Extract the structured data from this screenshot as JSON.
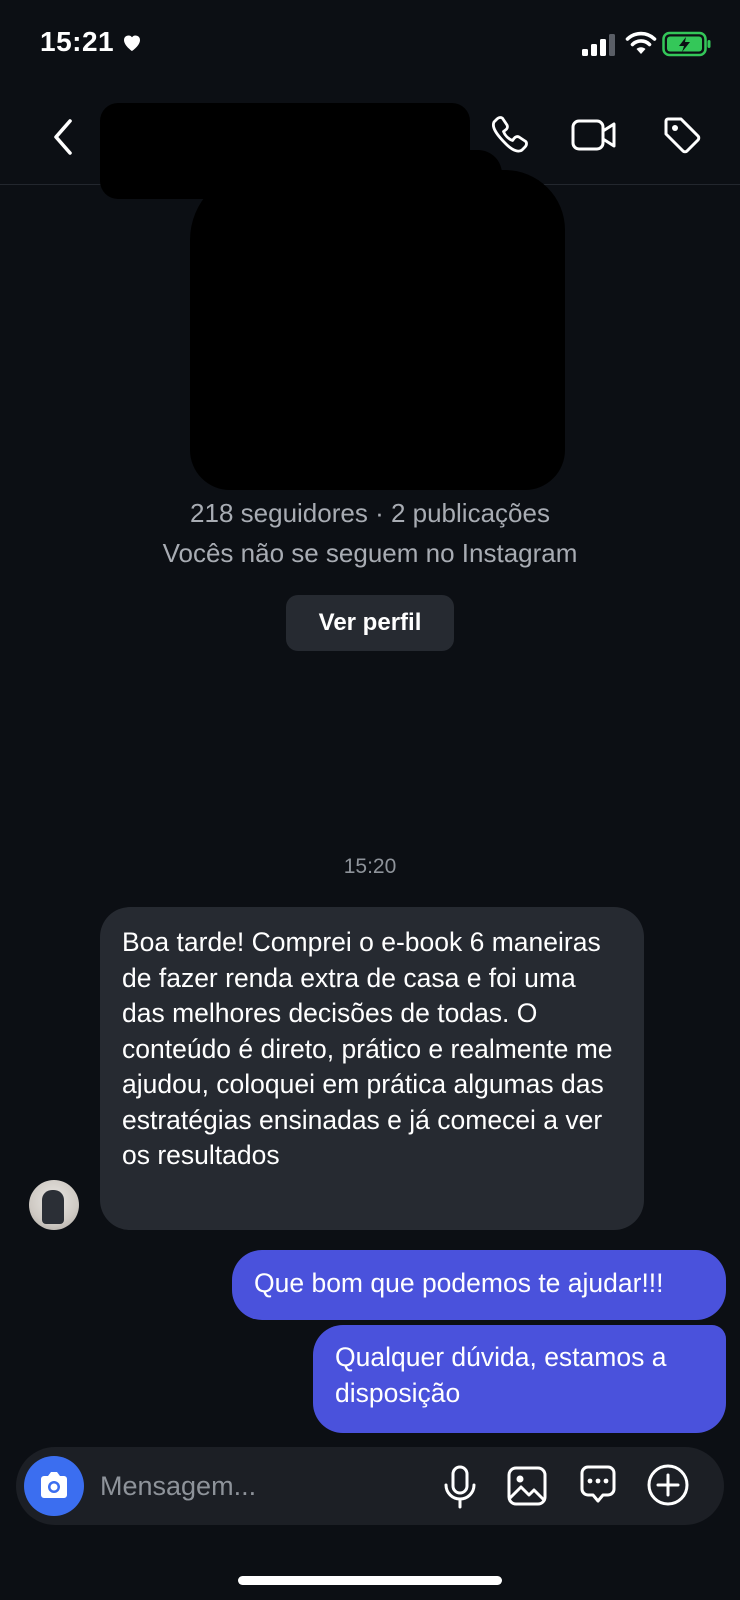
{
  "status_bar": {
    "time": "15:21",
    "heart_icon": "heart-icon",
    "signal_icon": "cellular-signal-icon",
    "wifi_icon": "wifi-icon",
    "battery_icon": "battery-charging-icon",
    "battery_color": "#34c759"
  },
  "header": {
    "back_icon": "chevron-left-icon",
    "call_icon": "phone-icon",
    "video_icon": "video-camera-icon",
    "tag_icon": "tag-icon"
  },
  "profile": {
    "stats": "218 seguidores · 2 publicações",
    "follow_status": "Vocês não se seguem no Instagram",
    "view_profile_label": "Ver perfil"
  },
  "conversation": {
    "timestamp": "15:20",
    "incoming": [
      {
        "text": "Boa tarde! Comprei o e-book 6 maneiras de fazer renda extra de casa e foi uma das melhores decisões de todas. O conteúdo é direto, prático e realmente me ajudou, coloquei em prática algumas das estratégias ensinadas e já comecei a ver os resultados"
      }
    ],
    "outgoing": [
      {
        "text": "Que bom que podemos te ajudar!!!"
      },
      {
        "text": "Qualquer dúvida, estamos a disposição"
      }
    ],
    "outgoing_color": "#4a52dc",
    "incoming_color": "#262a31"
  },
  "composer": {
    "placeholder": "Mensagem...",
    "camera_icon": "camera-icon",
    "mic_icon": "microphone-icon",
    "gallery_icon": "image-gallery-icon",
    "sticker_icon": "sticker-chat-icon",
    "plus_icon": "plus-circle-icon",
    "camera_button_color": "#3b6ef0"
  }
}
